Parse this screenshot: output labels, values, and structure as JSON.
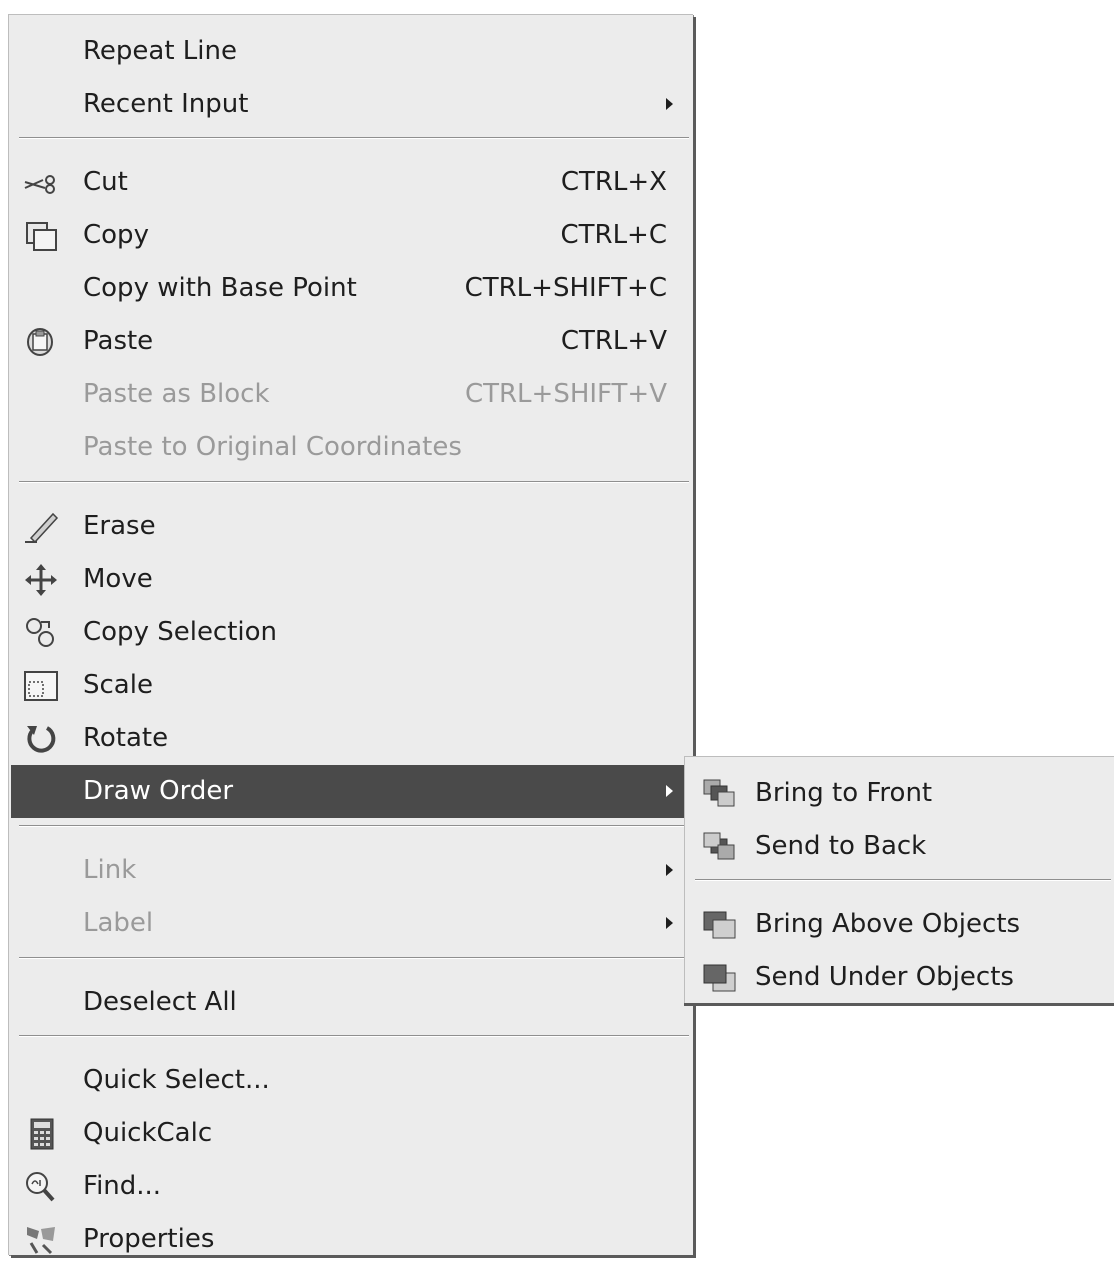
{
  "context_menu": {
    "items": [
      {
        "label": "Repeat Line"
      },
      {
        "label": "Recent Input"
      },
      {
        "label": "Cut",
        "shortcut": "CTRL+X"
      },
      {
        "label": "Copy",
        "shortcut": "CTRL+C"
      },
      {
        "label": "Copy with Base Point",
        "shortcut": "CTRL+SHIFT+C"
      },
      {
        "label": "Paste",
        "shortcut": "CTRL+V"
      },
      {
        "label": "Paste as Block",
        "shortcut": "CTRL+SHIFT+V",
        "disabled": true
      },
      {
        "label": "Paste to Original Coordinates",
        "disabled": true
      },
      {
        "label": "Erase"
      },
      {
        "label": "Move"
      },
      {
        "label": "Copy Selection"
      },
      {
        "label": "Scale"
      },
      {
        "label": "Rotate"
      },
      {
        "label": "Draw Order",
        "selected": true
      },
      {
        "label": "Link",
        "disabled": true
      },
      {
        "label": "Label",
        "disabled": true
      },
      {
        "label": "Deselect All"
      },
      {
        "label": "Quick Select..."
      },
      {
        "label": "QuickCalc"
      },
      {
        "label": "Find..."
      },
      {
        "label": "Properties"
      }
    ]
  },
  "draw_order_submenu": {
    "items": [
      {
        "label": "Bring to Front"
      },
      {
        "label": "Send to Back"
      },
      {
        "label": "Bring Above Objects"
      },
      {
        "label": "Send Under Objects"
      }
    ]
  },
  "colors": {
    "menu_bg": "#ececec",
    "highlight": "#4a4a4a",
    "text": "#1e1e1e",
    "disabled_text": "#9a9a9a"
  }
}
